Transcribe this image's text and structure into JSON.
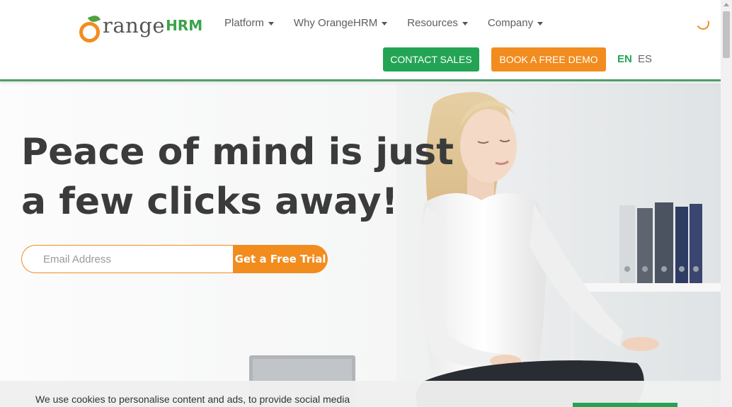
{
  "header": {
    "logo_main": "range",
    "logo_hrm": "HRM",
    "nav": [
      {
        "label": "Platform"
      },
      {
        "label": "Why OrangeHRM"
      },
      {
        "label": "Resources"
      },
      {
        "label": "Company"
      }
    ],
    "contact_sales": "CONTACT SALES",
    "book_demo": "BOOK A FREE DEMO",
    "lang_en": "EN",
    "lang_es": "ES"
  },
  "hero": {
    "headline": "Peace of mind is just a few clicks away!",
    "email_placeholder": "Email Address",
    "trial_button": "Get a Free Trial"
  },
  "cookie": {
    "text": "We use cookies to personalise content and ads, to provide social media"
  },
  "colors": {
    "brand_orange": "#f28c1e",
    "brand_green": "#23a455",
    "headline": "#3b3b3b"
  }
}
